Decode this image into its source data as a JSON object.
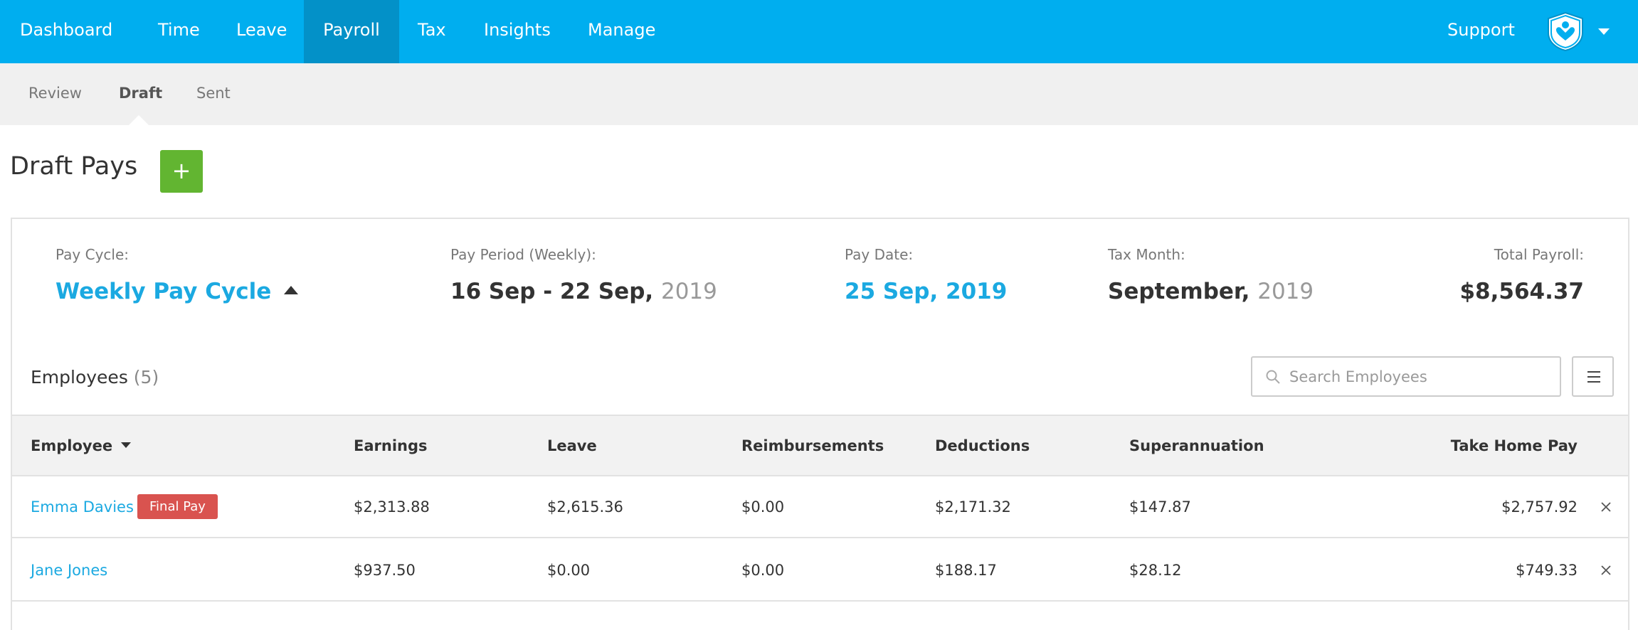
{
  "topnav": {
    "items": [
      "Dashboard",
      "Time",
      "Leave",
      "Payroll",
      "Tax",
      "Insights",
      "Manage"
    ],
    "active": "Payroll",
    "support": "Support"
  },
  "subnav": {
    "items": [
      "Review",
      "Draft",
      "Sent"
    ],
    "active": "Draft"
  },
  "page": {
    "title": "Draft Pays",
    "add_label": "+"
  },
  "summary": {
    "pay_cycle_label": "Pay Cycle:",
    "pay_cycle_value": "Weekly Pay Cycle",
    "pay_period_label": "Pay Period (Weekly):",
    "pay_period_main": "16 Sep - 22 Sep,",
    "pay_period_year": "2019",
    "pay_date_label": "Pay Date:",
    "pay_date_value": "25 Sep, 2019",
    "tax_month_label": "Tax Month:",
    "tax_month_main": "September,",
    "tax_month_year": "2019",
    "total_label": "Total Payroll:",
    "total_value": "$8,564.37"
  },
  "employees": {
    "heading": "Employees",
    "count": "(5)",
    "search_placeholder": "Search Employees"
  },
  "table": {
    "headers": {
      "employee": "Employee",
      "earnings": "Earnings",
      "leave": "Leave",
      "reimbursements": "Reimbursements",
      "deductions": "Deductions",
      "superannuation": "Superannuation",
      "take_home": "Take Home Pay"
    },
    "rows": [
      {
        "name": "Emma Davies",
        "badge": "Final Pay",
        "earnings": "$2,313.88",
        "leave": "$2,615.36",
        "reimbursements": "$0.00",
        "deductions": "$2,171.32",
        "superannuation": "$147.87",
        "take_home": "$2,757.92"
      },
      {
        "name": "Jane Jones",
        "earnings": "$937.50",
        "leave": "$0.00",
        "reimbursements": "$0.00",
        "deductions": "$188.17",
        "superannuation": "$28.12",
        "take_home": "$749.33"
      }
    ]
  },
  "colors": {
    "nav_bg": "#00aeef",
    "nav_active": "#0391c8",
    "link": "#1ba9e1",
    "add_button": "#62b531",
    "badge": "#d9534f"
  }
}
